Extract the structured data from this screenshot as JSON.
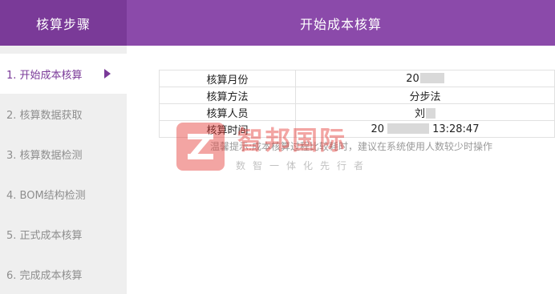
{
  "sidebar": {
    "title": "核算步骤",
    "steps": [
      {
        "label": "1. 开始成本核算"
      },
      {
        "label": "2. 核算数据获取"
      },
      {
        "label": "3. 核算数据检测"
      },
      {
        "label": "4. BOM结构检测"
      },
      {
        "label": "5. 正式成本核算"
      },
      {
        "label": "6. 完成成本核算"
      }
    ]
  },
  "main": {
    "title": "开始成本核算",
    "info": {
      "month_label": "核算月份",
      "month_value": "20",
      "method_label": "核算方法",
      "method_value": "分步法",
      "person_label": "核算人员",
      "person_value": "刘",
      "time_label": "核算时间",
      "time_value_prefix": "20",
      "time_value_suffix": "13:28:47"
    },
    "notice": "温馨提示:成本核算过程比较耗时，建议在系统使用人数较少时操作"
  },
  "watermark": {
    "title": "智邦国际",
    "subtitle": "数智一体化先行者"
  },
  "colors": {
    "sidebar_header": "#7a3a98",
    "main_header": "#8b4aaa",
    "active_step": "#7a3a98",
    "sidebar_bg": "#efefef"
  }
}
